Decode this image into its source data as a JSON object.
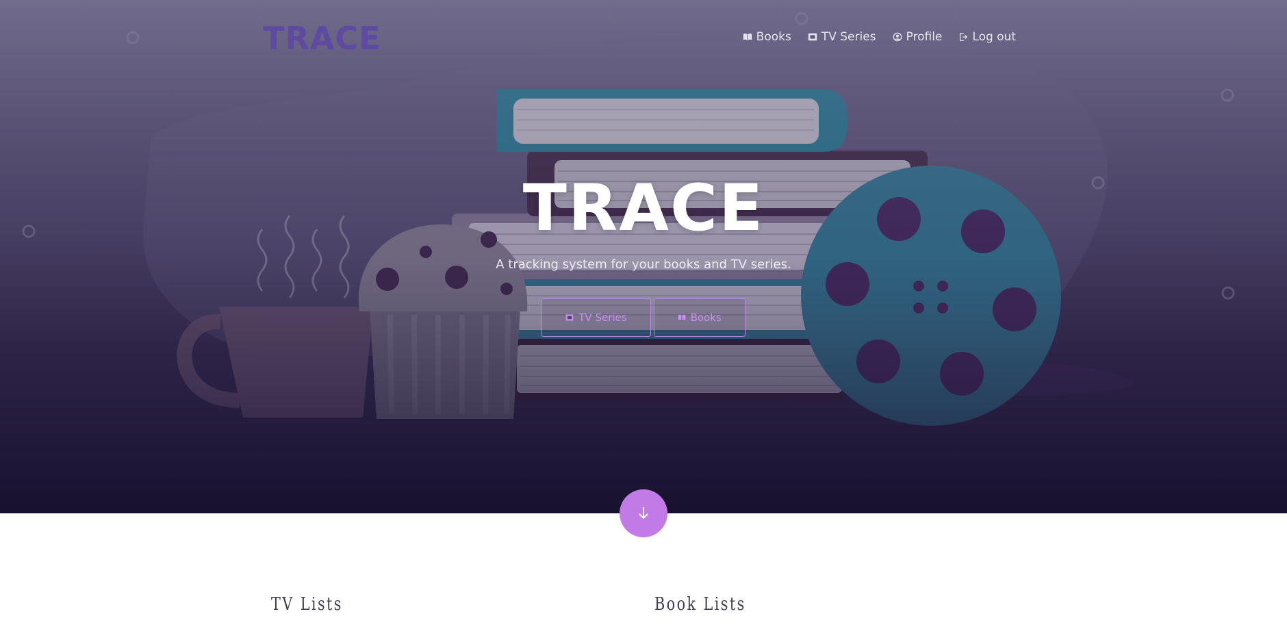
{
  "brand": {
    "logo_text": "TRACE"
  },
  "nav": {
    "items": [
      {
        "label": "Books",
        "icon": "book-icon"
      },
      {
        "label": "TV Series",
        "icon": "film-icon"
      },
      {
        "label": "Profile",
        "icon": "user-circle-icon"
      },
      {
        "label": "Log out",
        "icon": "logout-icon"
      }
    ]
  },
  "hero": {
    "title": "TRACE",
    "subtitle": "A tracking system for your books and TV series.",
    "buttons": [
      {
        "label": "TV Series",
        "icon": "film-icon"
      },
      {
        "label": "Books",
        "icon": "book-icon"
      }
    ],
    "scroll_icon": "arrow-down-icon"
  },
  "sections": {
    "left_heading": "TV Lists",
    "right_heading": "Book Lists"
  },
  "colors": {
    "accent": "#c27be6",
    "brand": "#5e4aa0",
    "hero_top": "#75708f",
    "hero_bottom": "#1b1335",
    "teal": "#2a7f96"
  }
}
